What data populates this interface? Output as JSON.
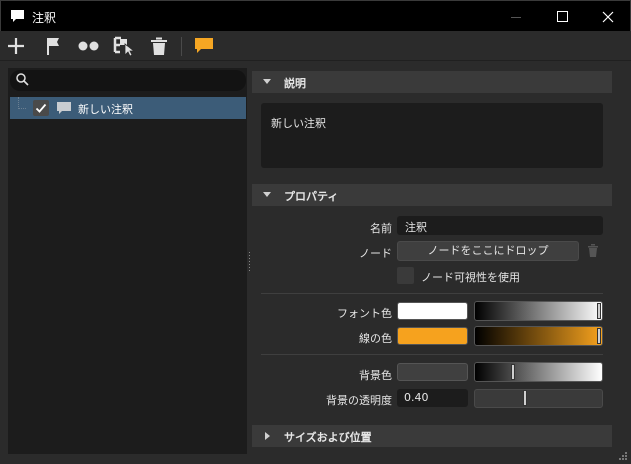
{
  "window": {
    "title": "注釈",
    "minimize_icon": "minimize-icon",
    "maximize_icon": "maximize-icon",
    "close_icon": "close-icon"
  },
  "toolbar": {
    "items": [
      "add-icon",
      "flag-icon",
      "dots-icon",
      "node-pointer-icon",
      "trash-icon",
      "annotation-comment-icon"
    ],
    "accent": "#f5a623"
  },
  "tree": {
    "search_placeholder": "",
    "items": [
      {
        "label": "新しい注釈",
        "checked": true,
        "selected": true
      }
    ]
  },
  "description_section": {
    "title": "説明",
    "expanded": true,
    "text": "新しい注釈"
  },
  "properties_section": {
    "title": "プロパティ",
    "expanded": true,
    "name_label": "名前",
    "name_value": "注釈",
    "node_label": "ノード",
    "node_button": "ノードをここにドロップ",
    "node_visibility_label": "ノード可視性を使用",
    "node_visibility_checked": false,
    "font_color_label": "フォント色",
    "font_color": "#ffffff",
    "font_color_level": 1.0,
    "line_color_label": "線の色",
    "line_color": "#f6a21e",
    "line_color_level": 1.0,
    "background_color_label": "背景色",
    "background_color": "#404040",
    "background_color_level": 0.3,
    "background_opacity_label": "背景の透明度",
    "background_opacity_value": "0.40",
    "background_opacity_level": 0.4
  },
  "size_section": {
    "title": "サイズおよび位置",
    "expanded": false
  }
}
